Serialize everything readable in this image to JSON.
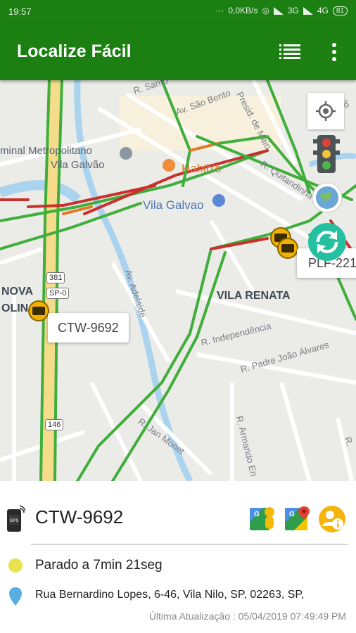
{
  "status_bar": {
    "time": "19:57",
    "network_speed": "0,0KB/s",
    "network_3g": "3G",
    "network_4g": "4G",
    "battery": "81"
  },
  "app_bar": {
    "title": "Localize Fácil",
    "list_icon": "list-icon",
    "more_icon": "more-vert-icon"
  },
  "map": {
    "labels": {
      "terminal_1": "minal Metropolitano",
      "terminal_2": "Vila Galvão",
      "habibs": "Habib's",
      "vila_galvao": "Vila Galvao",
      "vila_renata": "VILA RENATA",
      "nova": "NOVA",
      "olin": "OLIN",
      "street_santo": "R. Santo",
      "street_sao_bento": "Av. São Bento",
      "street_pres": "Presid. de Maio",
      "street_quitandinha": "R. Quitandinha",
      "street_d": "R. d'",
      "street_adelaide": "Av. Adelaide",
      "street_independencia": "R. Independência",
      "street_padre": "R. Padre João Álvares",
      "street_jan_monet": "R. Jan Monet",
      "street_armando": "R. Armando En",
      "street_r": "R."
    },
    "shields": [
      "381",
      "SP-0",
      "146"
    ],
    "vehicles": [
      {
        "plate": "CTW-9692"
      },
      {
        "plate": "PLF-221"
      }
    ],
    "controls": {
      "locate_icon": "my-location-icon",
      "traffic_icon": "traffic-light-icon",
      "satellite_icon": "satellite-globe-icon",
      "refresh_icon": "refresh-icon"
    }
  },
  "vehicle_info": {
    "device_icon": "gps-tracker-icon",
    "plate": "CTW-9692",
    "actions": [
      "street-view-icon",
      "google-maps-icon",
      "info-icon"
    ],
    "status_color": "#e8e34a",
    "status": "Parado a 7min 21seg",
    "address_icon": "map-pin-icon",
    "address": "Rua Bernardino Lopes, 6-46, Vila Nilo, SP, 02263, SP,",
    "last_update": "Última Atualização : 05/04/2019 07:49:49 PM"
  },
  "colors": {
    "primary": "#1b7f12",
    "traffic_green": "#3fae3a",
    "traffic_red": "#c9302c",
    "traffic_orange": "#e07b2a",
    "marker": "#f2b300",
    "refresh": "#25c0a0"
  }
}
